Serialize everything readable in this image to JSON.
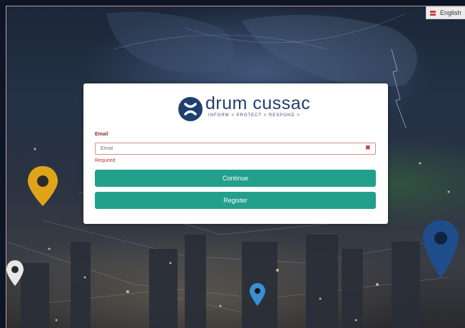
{
  "language": {
    "label": "English",
    "icon": "flag-icon"
  },
  "logo": {
    "brand": "drum cussac",
    "tagline": "INFORM > PROTECT > RESPOND >",
    "icon": "x-logo-icon"
  },
  "form": {
    "email_label": "Email",
    "email_placeholder": "Email",
    "email_value": "",
    "clear_icon": "close-icon",
    "error_text": "Required",
    "continue_label": "Continue",
    "register_label": "Register"
  },
  "colors": {
    "accent": "#22a08c",
    "brand": "#1f3f6e",
    "error": "#b33333",
    "pin_yellow": "#e0a41a",
    "pin_blue": "#1f4d8c",
    "pin_light_blue": "#3a8fd0"
  }
}
